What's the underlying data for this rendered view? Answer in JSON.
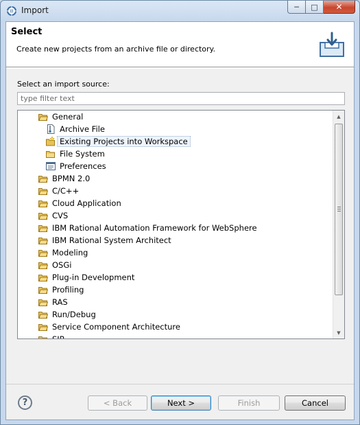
{
  "window": {
    "title": "Import",
    "icon": "eclipse-app-icon"
  },
  "header": {
    "title": "Select",
    "description": "Create new projects from an archive file or directory.",
    "icon": "import-tray-icon"
  },
  "source": {
    "label": "Select an import source:",
    "filter_placeholder": "type filter text",
    "filter_value": ""
  },
  "tree": {
    "items": [
      {
        "label": "General",
        "type": "folder",
        "expanded": true,
        "level": 0
      },
      {
        "label": "Archive File",
        "type": "archive",
        "level": 1
      },
      {
        "label": "Existing Projects into Workspace",
        "type": "project",
        "level": 1,
        "selected": true
      },
      {
        "label": "File System",
        "type": "folder-leaf",
        "level": 1
      },
      {
        "label": "Preferences",
        "type": "preferences",
        "level": 1
      },
      {
        "label": "BPMN 2.0",
        "type": "folder",
        "level": 0
      },
      {
        "label": "C/C++",
        "type": "folder",
        "level": 0
      },
      {
        "label": "Cloud Application",
        "type": "folder",
        "level": 0
      },
      {
        "label": "CVS",
        "type": "folder",
        "level": 0
      },
      {
        "label": "IBM Rational Automation Framework for WebSphere",
        "type": "folder",
        "level": 0
      },
      {
        "label": "IBM Rational System Architect",
        "type": "folder",
        "level": 0
      },
      {
        "label": "Modeling",
        "type": "folder",
        "level": 0
      },
      {
        "label": "OSGi",
        "type": "folder",
        "level": 0
      },
      {
        "label": "Plug-in Development",
        "type": "folder",
        "level": 0
      },
      {
        "label": "Profiling",
        "type": "folder",
        "level": 0
      },
      {
        "label": "RAS",
        "type": "folder",
        "level": 0
      },
      {
        "label": "Run/Debug",
        "type": "folder",
        "level": 0
      },
      {
        "label": "Service Component Architecture",
        "type": "folder",
        "level": 0
      },
      {
        "label": "SIP",
        "type": "folder",
        "level": 0
      }
    ]
  },
  "buttons": {
    "help": "?",
    "back": "< Back",
    "next": "Next >",
    "finish": "Finish",
    "cancel": "Cancel"
  },
  "colors": {
    "folder": "#e8c25a",
    "selection_border": "#9ab0cc",
    "default_button_border": "#3c7fb1"
  }
}
